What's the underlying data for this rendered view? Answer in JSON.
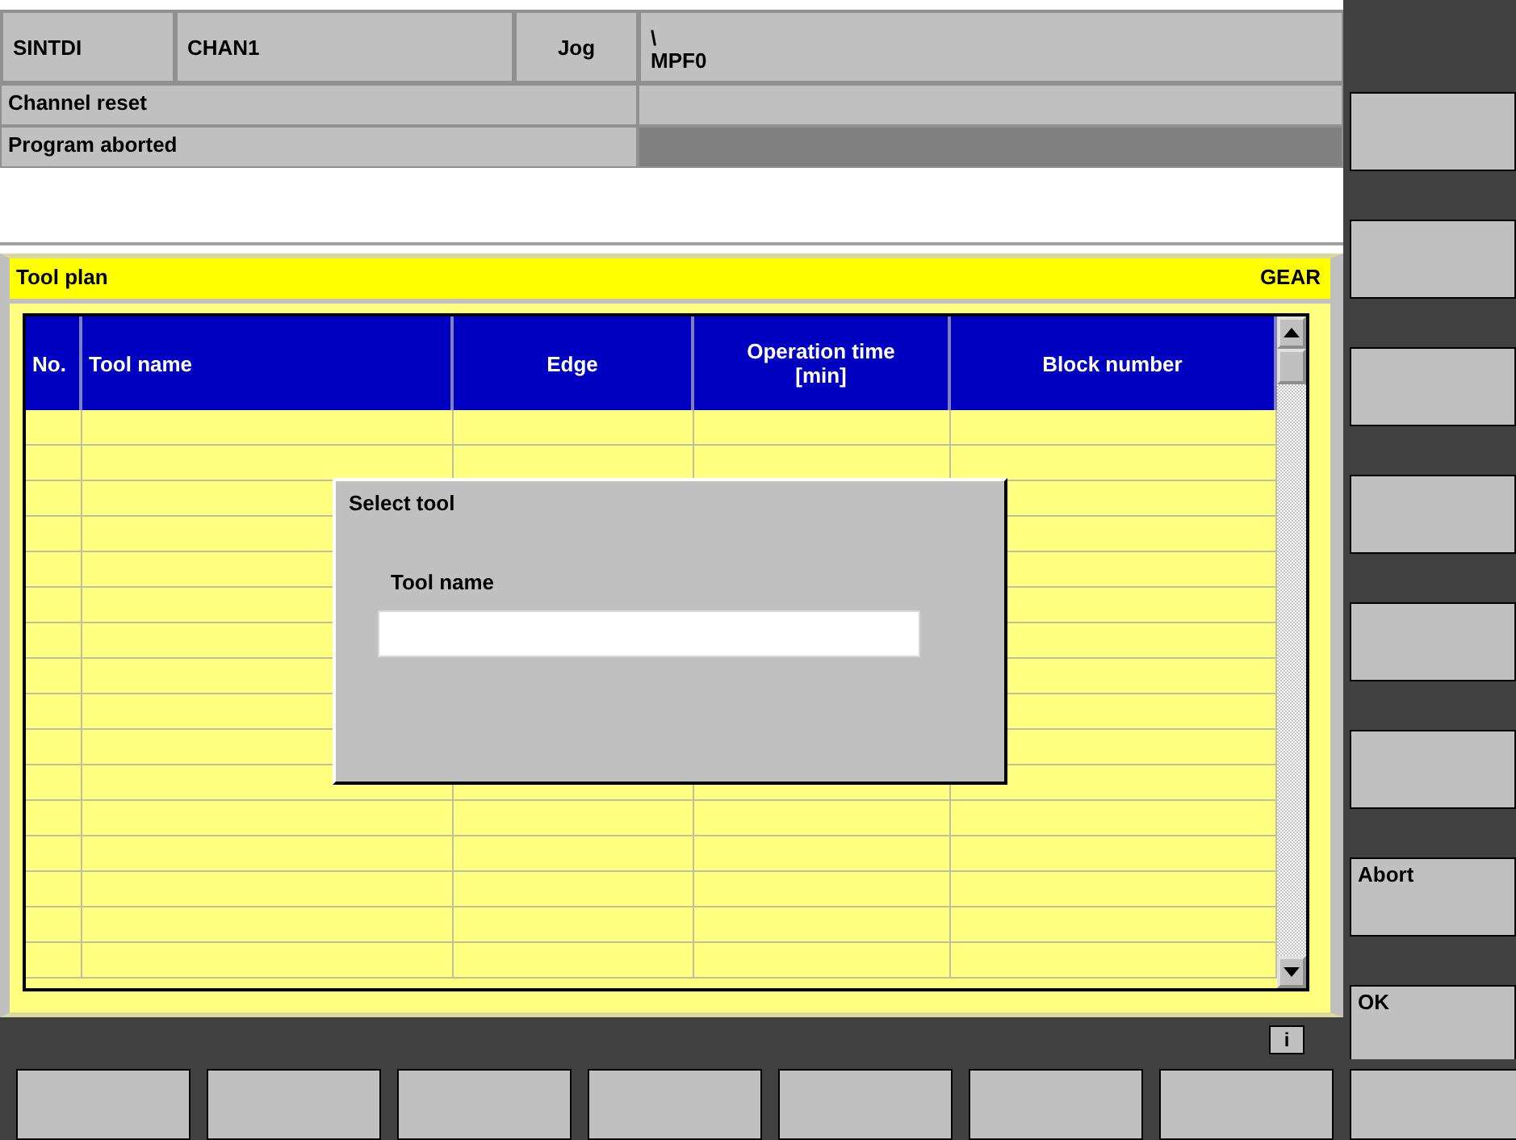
{
  "header": {
    "machine": "SINTDI",
    "channel": "CHAN1",
    "mode": "Jog",
    "path": [
      "\\",
      "MPF0"
    ]
  },
  "status": {
    "channel_state": "Channel reset",
    "program_state": "Program aborted"
  },
  "tool_plan": {
    "title": "Tool plan",
    "workpiece": "GEAR",
    "columns": [
      "No.",
      "Tool  name",
      "Edge",
      "Operation  time\n[min]",
      "Block number"
    ]
  },
  "dialog": {
    "title": "Select tool",
    "field_label": "Tool name"
  },
  "info_button": "i",
  "vertical_softkeys": [
    {
      "kind": "blank"
    },
    {
      "kind": "blank"
    },
    {
      "kind": "blank"
    },
    {
      "kind": "blank"
    },
    {
      "kind": "blank"
    },
    {
      "kind": "blank"
    },
    {
      "kind": "labeled",
      "label": "Abort"
    },
    {
      "kind": "labeled",
      "label": "OK"
    }
  ],
  "horizontal_softkeys": [
    {
      "kind": "blank"
    },
    {
      "kind": "blank"
    },
    {
      "kind": "blank"
    },
    {
      "kind": "blank"
    },
    {
      "kind": "blank"
    },
    {
      "kind": "blank"
    },
    {
      "kind": "blank"
    },
    {
      "kind": "blank"
    }
  ]
}
